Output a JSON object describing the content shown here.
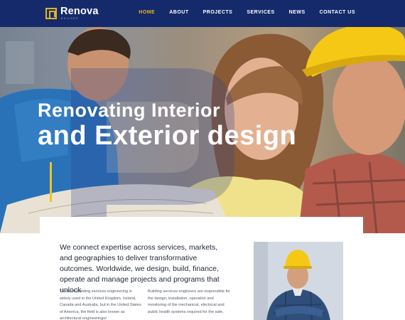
{
  "brand": {
    "name": "Renova",
    "sub": "BUILDER"
  },
  "nav": {
    "items": [
      {
        "label": "HOME",
        "active": true
      },
      {
        "label": "ABOUT",
        "active": false
      },
      {
        "label": "PROJECTS",
        "active": false
      },
      {
        "label": "SERVICES",
        "active": false
      },
      {
        "label": "NEWS",
        "active": false
      },
      {
        "label": "CONTACT US",
        "active": false
      }
    ]
  },
  "hero": {
    "title_line1": "Renovating Interior",
    "title_line2": "and Exterior design"
  },
  "content": {
    "lead": "We connect expertise across services, markets, and geographies to deliver transformative outcomes. Worldwide, we design, build, finance, operate and manage projects and programs that unlock",
    "col1": "The term building services engineering is widely used in the United Kingdom, Ireland, Canada and Australia, but in the United States of America, the field is also known as architectural engineeringor",
    "col2": "Building services engineers are responsible for the design, installation, operation and monitoring of the mechanical, electrical and public health systems required for the safe,"
  },
  "colors": {
    "header_bg": "#142a6b",
    "accent": "#e4b326",
    "nav_active": "#e4b326"
  }
}
